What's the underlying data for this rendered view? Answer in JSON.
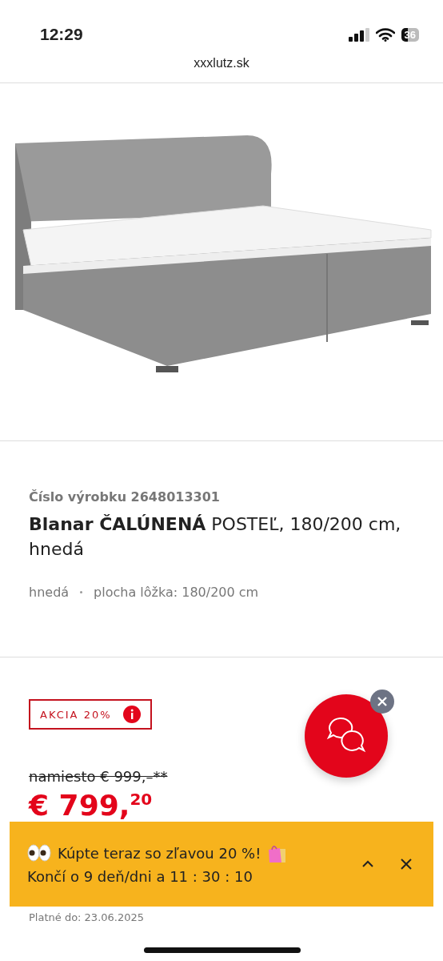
{
  "status_bar": {
    "time": "12:29",
    "battery": "36"
  },
  "browser": {
    "url": "xxxlutz.sk"
  },
  "product": {
    "number": "Číslo výrobku 2648013301",
    "title": "**Blanar ČALÚNENÁ** POSTEĽ, 180/200 cm, hnedá",
    "attributes": [
      "hnedá",
      "plocha lôžka: 180/200 cm"
    ]
  },
  "price": {
    "badge": "AKCIA 20%",
    "old_price": "namiesto € 999,–**",
    "price": "€ 799,$^{20}$",
    "valid_until": "Platné do: 23.06.2025"
  },
  "promo_banner": {
    "line_1": "Kúpte teraz so zľavou 20 %!",
    "line_2": "Končí o 9 deň/dni a  11 : 30 : 10"
  }
}
